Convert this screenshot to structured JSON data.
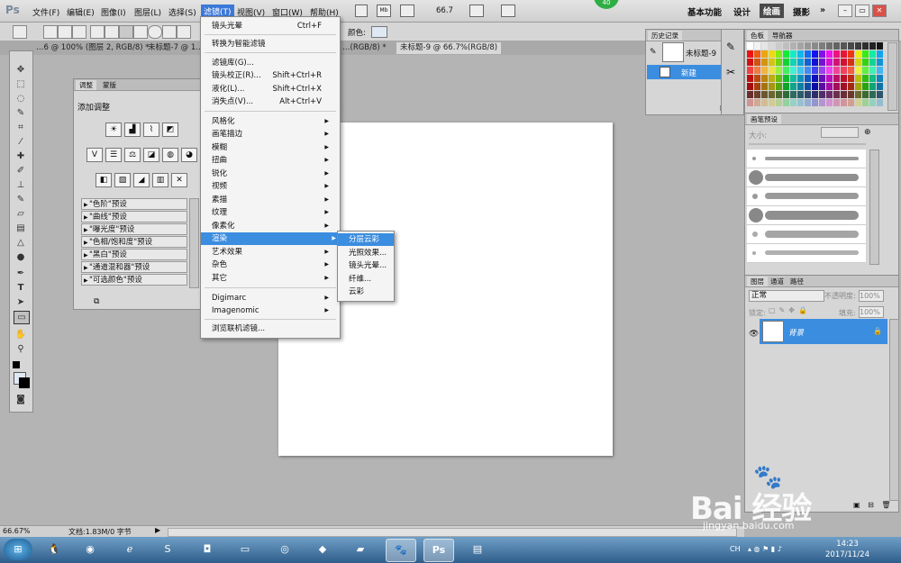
{
  "app": {
    "logo": "Ps",
    "badge": "40"
  },
  "menubar": {
    "items": [
      "文件(F)",
      "编辑(E)",
      "图像(I)",
      "图层(L)",
      "选择(S)",
      "滤镜(T)",
      "视图(V)",
      "窗口(W)",
      "帮助(H)"
    ],
    "zoom": "66.7",
    "workspaces": [
      "基本功能",
      "设计",
      "绘画",
      "摄影"
    ],
    "workspace_more": "»",
    "active_menu": "滤镜(T)",
    "active_workspace": "绘画"
  },
  "optionsbar": {
    "color_label": "颜色:"
  },
  "tabs": [
    "…6 @ 100% (图层 2, RGB/8) *",
    "未标题-7 @ 1…",
    "…(RGB/8) *",
    "未标题-9 @ 66.7%(RGB/8)"
  ],
  "filter_menu": {
    "group1": [
      {
        "label": "镜头光晕",
        "shortcut": "Ctrl+F"
      }
    ],
    "group2": [
      {
        "label": "转换为智能滤镜",
        "shortcut": ""
      }
    ],
    "group3": [
      {
        "label": "滤镜库(G)...",
        "shortcut": ""
      },
      {
        "label": "镜头校正(R)...",
        "shortcut": "Shift+Ctrl+R"
      },
      {
        "label": "液化(L)...",
        "shortcut": "Shift+Ctrl+X"
      },
      {
        "label": "消失点(V)...",
        "shortcut": "Alt+Ctrl+V"
      }
    ],
    "group4": [
      "风格化",
      "画笔描边",
      "模糊",
      "扭曲",
      "锐化",
      "视频",
      "素描",
      "纹理",
      "像素化",
      "渲染",
      "艺术效果",
      "杂色",
      "其它"
    ],
    "group5": [
      "Digimarc",
      "Imagenomic"
    ],
    "group6": [
      "浏览联机滤镜..."
    ],
    "highlighted": "渲染"
  },
  "render_submenu": {
    "items": [
      "分层云彩",
      "光照效果...",
      "镜头光晕...",
      "纤维...",
      "云彩"
    ],
    "highlighted": "分层云彩"
  },
  "adjustments": {
    "tabs": [
      "调整",
      "蒙版"
    ],
    "title": "添加调整",
    "presets": [
      "\"色阶\"预设",
      "\"曲线\"预设",
      "\"曝光度\"预设",
      "\"色相/饱和度\"预设",
      "\"黑白\"预设",
      "\"通道混和器\"预设",
      "\"可选颜色\"预设"
    ]
  },
  "history": {
    "tab": "历史记录",
    "snapshot": "未标题-9",
    "step": "新建"
  },
  "swatches": {
    "tabs": [
      "色板",
      "导航器"
    ]
  },
  "brushes": {
    "tab": "画笔预设",
    "size_label": "大小:"
  },
  "layers": {
    "tabs": [
      "图层",
      "通道",
      "路径"
    ],
    "blend_mode": "正常",
    "opacity_label": "不透明度:",
    "opacity": "100%",
    "lock_label": "锁定:",
    "fill_label": "填充:",
    "fill": "100%",
    "layer_name": "背景"
  },
  "status": {
    "zoom": "66.67%",
    "doc": "文档:1.83M/0 字节"
  },
  "taskbar": {
    "lang": "CH",
    "time": "14:23",
    "date": "2017/11/24"
  },
  "watermark": {
    "text": "Bai 经验",
    "url": "jingyan.baidu.com"
  },
  "colors": {
    "accent": "#3b8de0",
    "menubar": "#d6d6d6",
    "taskbar": "#3b6ea0"
  }
}
